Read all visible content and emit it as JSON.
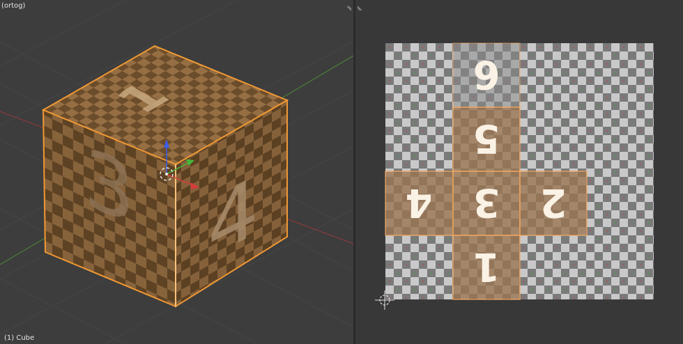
{
  "viewport": {
    "view_label": "(ortog)",
    "object_label": "(1) Cube",
    "faces": {
      "top": "1",
      "left": "3",
      "right": "4"
    },
    "colors": {
      "background": "#3d3d3d",
      "grid": "#474747",
      "axis_x": "#9b3a3a",
      "axis_y": "#4e8a3b",
      "selection": "#f39a34",
      "checker_dark": "#5a4228",
      "checker_light": "#8a6a45"
    }
  },
  "uv_editor": {
    "islands": [
      "6",
      "5",
      "4",
      "3",
      "2",
      "1"
    ],
    "colors": {
      "background": "#383838",
      "checker_dark": "#7a7a7a",
      "checker_light": "#c9c9c9",
      "island_fill": "#9a7450",
      "island_edge": "#f5a65a"
    }
  }
}
